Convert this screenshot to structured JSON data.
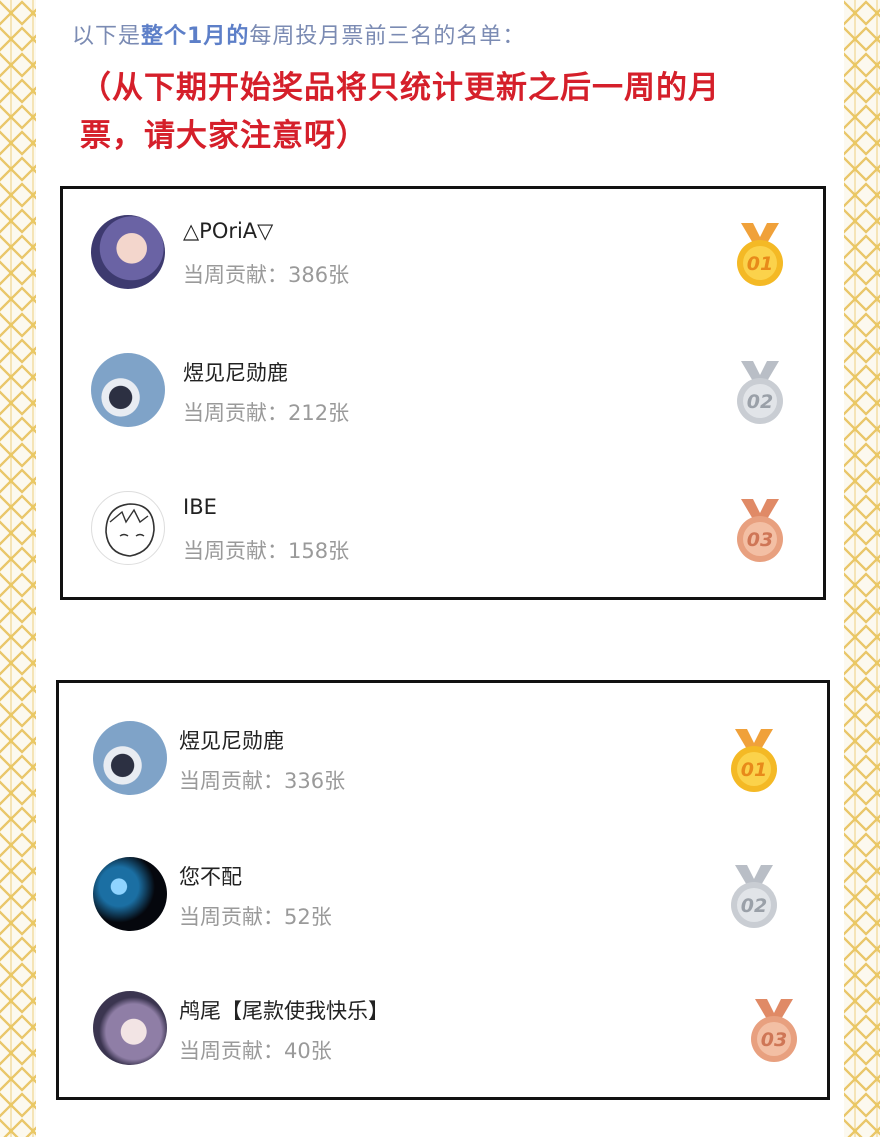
{
  "intro": {
    "prefix": "以下是",
    "highlight": "整个1月的",
    "suffix": "每周投月票前三名的名单："
  },
  "notice": "（从下期开始奖品将只统计更新之后一周的月票，请大家注意呀）",
  "week_1": [
    {
      "name": "△POriA▽",
      "contribution": "当周贡献：386张",
      "rank": "01"
    },
    {
      "name": "煜见尼勋鹿",
      "contribution": "当周贡献：212张",
      "rank": "02"
    },
    {
      "name": "IBE",
      "contribution": "当周贡献：158张",
      "rank": "03"
    }
  ],
  "week_2": [
    {
      "name": "煜见尼勋鹿",
      "contribution": "当周贡献：336张",
      "rank": "01"
    },
    {
      "name": "您不配",
      "contribution": "当周贡献：52张",
      "rank": "02"
    },
    {
      "name": "鸬尾【尾款使我快乐】",
      "contribution": "当周贡献：40张",
      "rank": "03"
    }
  ],
  "medal_colors": {
    "gold": "#f4b925",
    "silver": "#c9cdd3",
    "bronze": "#e8a07f"
  }
}
